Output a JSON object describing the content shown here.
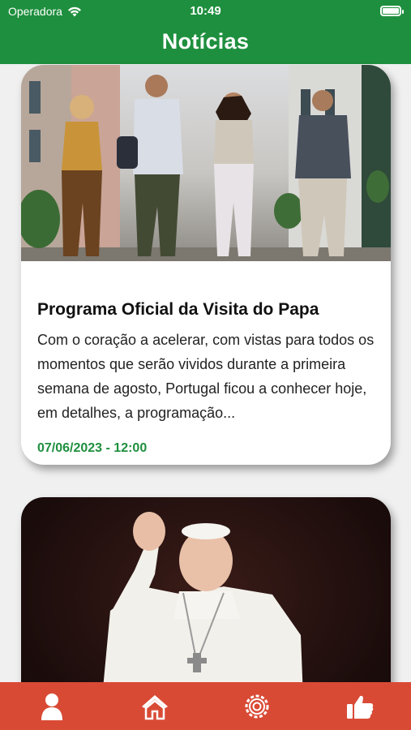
{
  "status_bar": {
    "carrier": "Operadora",
    "time": "10:49"
  },
  "header": {
    "title": "Notícias"
  },
  "news": [
    {
      "title": "Programa Oficial da Visita do Papa",
      "text": "Com o coração a acelerar, com vistas para todos os momentos que serão vividos durante a primeira semana de agosto, Portugal ficou a conhecer hoje, em detalhes, a programação...",
      "date": "07/06/2023 - 12:00"
    }
  ],
  "tabs": [
    {
      "icon": "profile-icon"
    },
    {
      "icon": "home-icon"
    },
    {
      "icon": "settings-gear-icon"
    },
    {
      "icon": "thumbs-up-icon"
    }
  ],
  "colors": {
    "header_green": "#1e8f3e",
    "tabbar_red": "#d94a35",
    "date_green": "#1e8f3e"
  }
}
